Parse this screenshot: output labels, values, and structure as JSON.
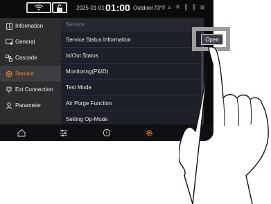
{
  "statusbar": {
    "date": "2025-01-01",
    "time": "01:00",
    "outdoor_label": "Outdoor",
    "temp": "73°F"
  },
  "sidebar": {
    "items": [
      {
        "label": "Information",
        "icon": "info-icon"
      },
      {
        "label": "General",
        "icon": "general-icon"
      },
      {
        "label": "Cascade",
        "icon": "cascade-icon"
      },
      {
        "label": "Service",
        "icon": "service-icon",
        "active": true
      },
      {
        "label": "Ext Connection",
        "icon": "ext-connection-icon"
      },
      {
        "label": "Parameter",
        "icon": "parameter-icon"
      }
    ]
  },
  "main": {
    "header": "Service",
    "items": [
      "Service Status Information",
      "In/Out Status",
      "Monitoring(P&ID)",
      "Test Mode",
      "Air Purge Function",
      "Setting Op-Mode"
    ],
    "open_button": "Open"
  },
  "colors": {
    "active_accent": "#ff8c1a",
    "sidebar_bg": "#2d2d30",
    "main_bg": "#1e2027"
  },
  "bottom_nav": [
    "home-icon",
    "sliders-icon",
    "power-icon",
    "settings-gear-icon"
  ]
}
